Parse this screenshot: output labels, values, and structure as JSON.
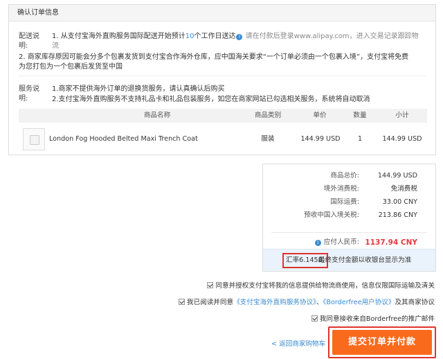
{
  "order_card": {
    "title": "确认订单信息",
    "shipping": {
      "label_line1": "配送说",
      "label_line2": "明:",
      "line1_prefix": "1. 从支付宝海外直购服务国际配送开始预计",
      "line1_days": "10",
      "line1_suffix": "个工作日送达",
      "line1_note": "请在付款后登录www.alipay.com，进入交易记录跟踪物",
      "line1_wrap": "流",
      "line2": "2. 商家库存原因可能会分多个包裹发货到支付宝合作海外仓库，应中国海关要求“一个订单必须由一个包裹入境”，支付宝将免费",
      "line3": "为您打包为一个包裹后发货至中国"
    },
    "service": {
      "label_line1": "服务说",
      "label_line2": "明:",
      "line1": "1.商家不提供海外订单的退换货服务，请认真确认后购买",
      "line2": "2.支付宝海外直购服务不支持礼品卡和礼品包装服务，如您在商家网站已勾选相关服务，系统将自动取消"
    },
    "table": {
      "headers": [
        "商品名称",
        "商品类别",
        "单价",
        "数量",
        "小计"
      ],
      "rows": [
        {
          "name": "London Fog Hooded Belted Maxi Trench Coat",
          "category": "服装",
          "price": "144.99 USD",
          "qty": "1",
          "subtotal": "144.99 USD"
        }
      ]
    }
  },
  "summary": {
    "items": [
      {
        "label": "商品总价:",
        "value": "144.99 USD"
      },
      {
        "label": "境外消费税:",
        "value": "免消费税"
      },
      {
        "label": "国际运费:",
        "value": "33.00 CNY"
      },
      {
        "label": "预收中国入境关税:",
        "value": "213.86 CNY"
      }
    ],
    "total_label": "应付人民币:",
    "total_value": "1137.94 CNY",
    "rate_highlight": "汇率6.1458,",
    "rate_rest": "最终支付金额以收银台显示为准"
  },
  "agreements": {
    "a1": "同意并授权支付宝将我的信息提供给物流商使用，信息仅限国际运输及清关",
    "a2_prefix": "我已阅读并同意",
    "a2_link1": "《支付宝海外直购服务协议》",
    "a2_sep": "、",
    "a2_link2": "《Borderfree用户协议》",
    "a2_suffix": "及其商家协议",
    "a3": "我同意接收来自Borderfree的推广邮件"
  },
  "actions": {
    "back": "< 返回商家购物车",
    "submit": "提交订单并付款"
  },
  "colors": {
    "accent_blue": "#3a8bd0",
    "total_red": "#e4393c",
    "submit_orange": "#fa6a1c",
    "highlight_red": "#e0322a"
  }
}
